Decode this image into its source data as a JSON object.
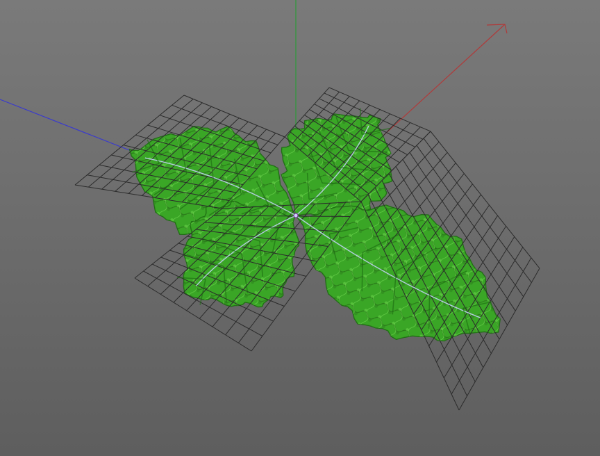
{
  "viewport": {
    "background_top": "#7a7a7a",
    "background_bottom": "#5e5e5e"
  },
  "axes": {
    "x_color": "#b03a3a",
    "y_color": "#2e9a3a",
    "z_color": "#3a3acd"
  },
  "grid_color": "#2b2b2b",
  "leaf_colors": {
    "base": "#2f9a1f",
    "light": "#6ee04a",
    "dark": "#1c6a12",
    "vein": "#c8d4ff"
  },
  "pivot_icon": "gizmo-center-icon"
}
